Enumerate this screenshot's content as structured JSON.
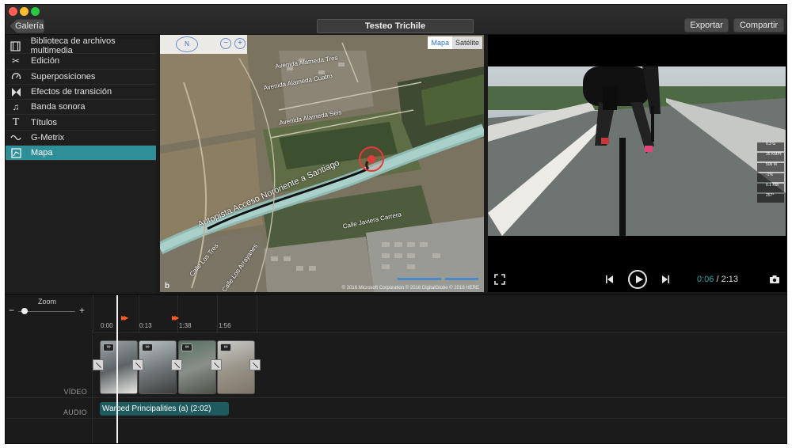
{
  "window": {
    "back_button": "Galería",
    "project_title": "Testeo Trichile",
    "export_button": "Exportar",
    "share_button": "Compartir"
  },
  "sidebar": {
    "items": [
      {
        "label": "Biblioteca de archivos multimedia",
        "icon": "film-icon"
      },
      {
        "label": "Edición",
        "icon": "scissors-icon"
      },
      {
        "label": "Superposiciones",
        "icon": "gauge-icon"
      },
      {
        "label": "Efectos de transición",
        "icon": "transition-icon"
      },
      {
        "label": "Banda sonora",
        "icon": "music-note-icon"
      },
      {
        "label": "Títulos",
        "icon": "text-icon"
      },
      {
        "label": "G-Metrix",
        "icon": "gmetrix-icon"
      },
      {
        "label": "Mapa",
        "icon": "map-icon"
      }
    ],
    "active_index": 7
  },
  "map": {
    "tabs": [
      "Mapa",
      "Satélite"
    ],
    "active_tab": "Mapa",
    "compass_label": "N",
    "zoom_out_label": "−",
    "zoom_in_label": "+",
    "labels": {
      "alameda_tres": "Avenida Alameda Tres",
      "alameda_cuatro": "Avenida Alameda Cuatro",
      "alameda_seis": "Avenida Alameda Seis",
      "road": "Autopista Acceso Nororiente a Santiago",
      "calle_los_tres": "Calle Los Tres",
      "calle_jaguera": "Calle Javiera Carrera",
      "calle_arrayanes": "Calle Los Arrayanes"
    },
    "copyright": "© 2016 Microsoft Corporation  © 2016 DigitalGlobe  © 2016 HERE",
    "provider": "b"
  },
  "video": {
    "current_time": "0:06",
    "total_time": "2:13",
    "separator": " / ",
    "overlay_badges": [
      "0.3 G",
      "35 KM/H",
      "506 M",
      "-1%",
      "0.1 KM",
      "257°"
    ]
  },
  "timeline": {
    "zoom_label": "Zoom",
    "zoom_minus": "−",
    "zoom_plus": "+",
    "zoom_level": 0.08,
    "ticks": [
      "0:00",
      "0:13",
      "1:38",
      "1:56"
    ],
    "video_track_label": "VÍDEO",
    "audio_track_label": "AUDIO",
    "audio_clip": "Warped Principalities (a)  (2:02)"
  },
  "colors": {
    "accent": "#2e8f98",
    "marker": "#ff5a1f",
    "audio_clip": "#1e5a5e"
  }
}
